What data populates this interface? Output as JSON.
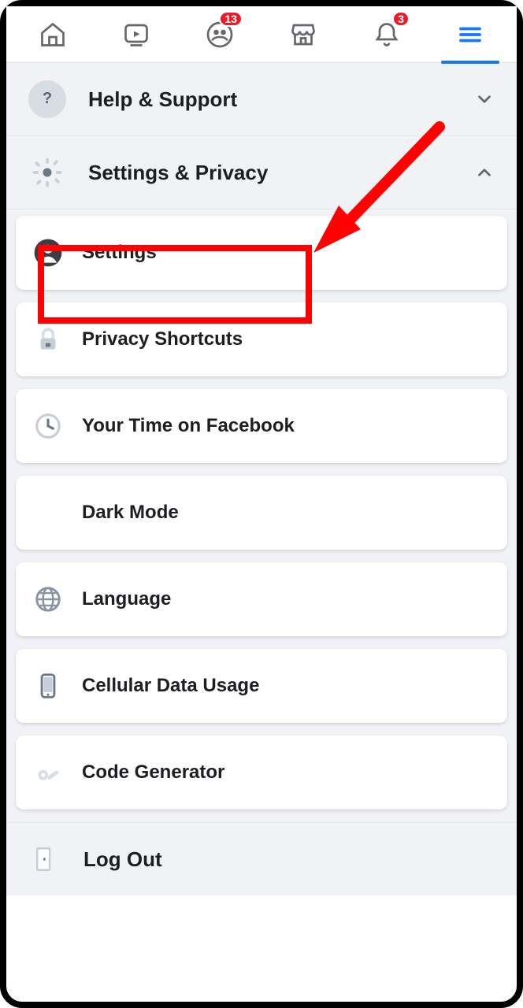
{
  "nav": {
    "badges": {
      "groups": "13",
      "notifications": "3"
    }
  },
  "sections": {
    "help": {
      "title": "Help & Support"
    },
    "settings_privacy": {
      "title": "Settings & Privacy"
    }
  },
  "items": {
    "settings": "Settings",
    "privacy_shortcuts": "Privacy Shortcuts",
    "your_time": "Your Time on Facebook",
    "dark_mode": "Dark Mode",
    "language": "Language",
    "cellular": "Cellular Data Usage",
    "code_gen": "Code Generator",
    "logout": "Log Out"
  }
}
